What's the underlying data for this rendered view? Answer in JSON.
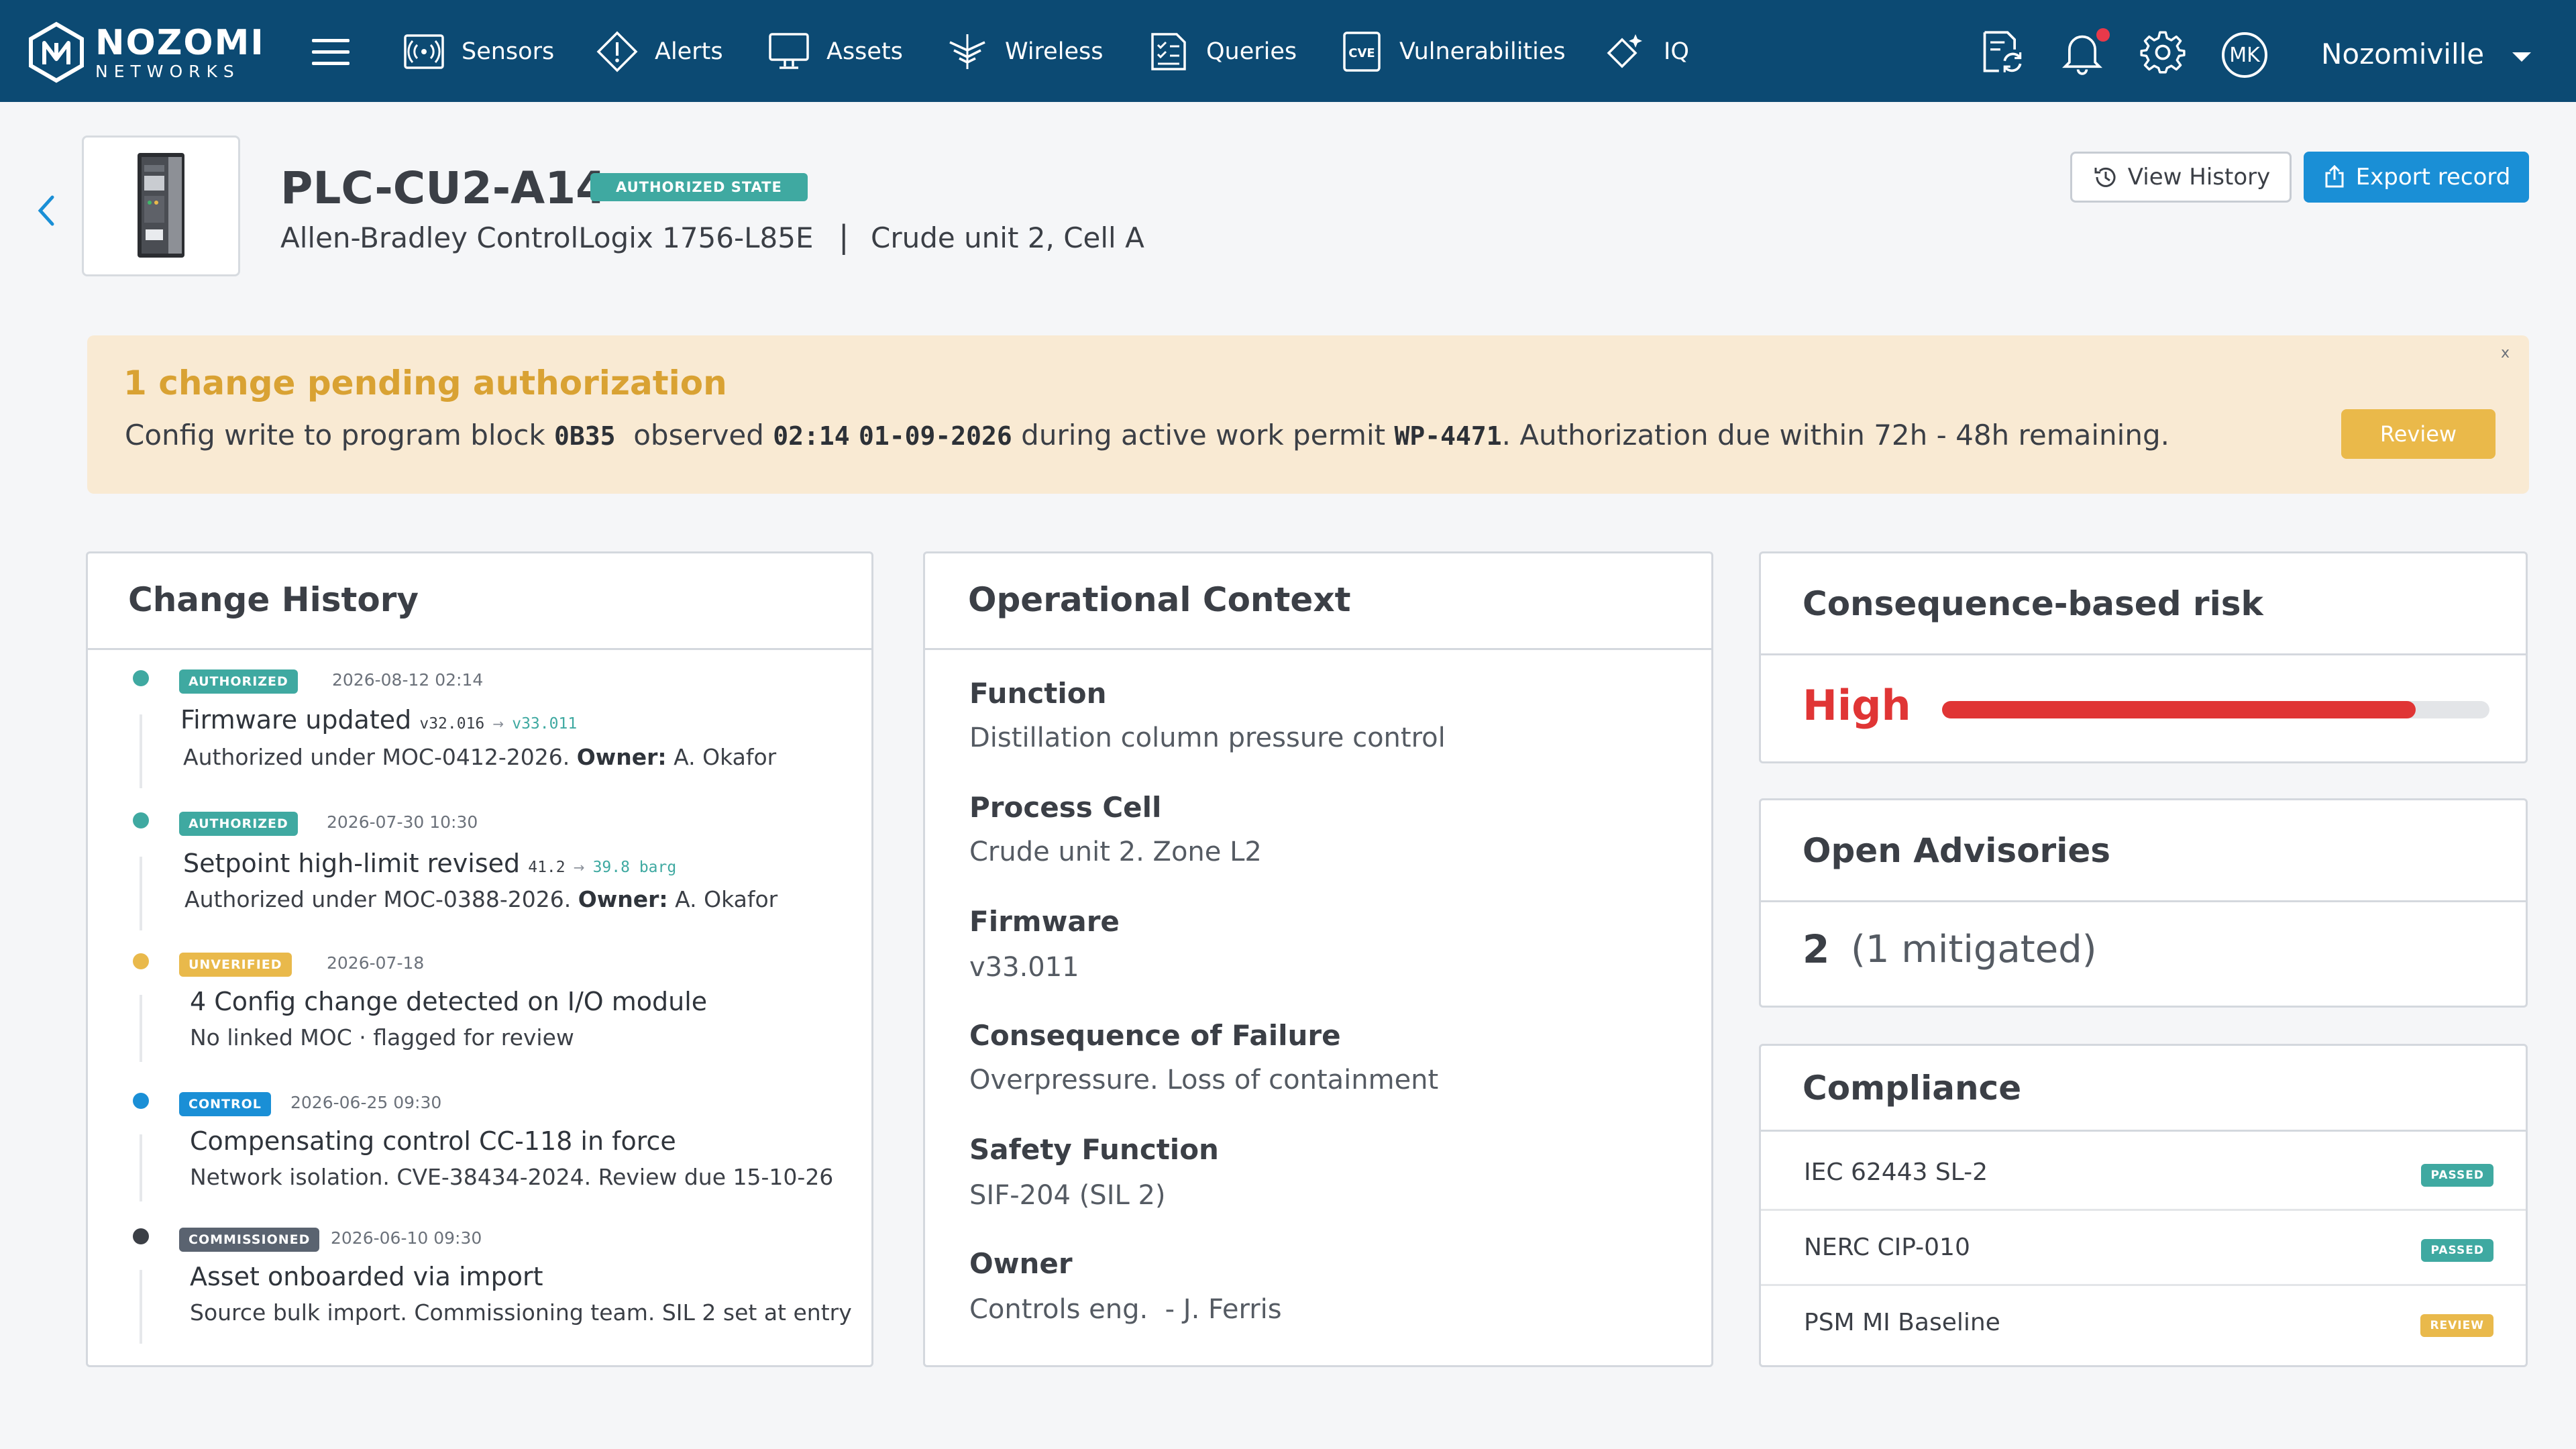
{
  "brand": {
    "line1": "NOZOMI",
    "line2": "NETWORKS"
  },
  "nav": {
    "items": [
      {
        "label": "Sensors",
        "icon": "sensor-icon"
      },
      {
        "label": "Alerts",
        "icon": "alert-icon"
      },
      {
        "label": "Assets",
        "icon": "monitor-icon"
      },
      {
        "label": "Wireless",
        "icon": "wireless-icon"
      },
      {
        "label": "Queries",
        "icon": "queries-icon"
      },
      {
        "label": "Vulnerabilities",
        "icon": "cve-icon"
      },
      {
        "label": "IQ",
        "icon": "iq-icon"
      }
    ],
    "cve_icon_text": "CVE",
    "user_initials": "MK",
    "site": "Nozomiville"
  },
  "asset": {
    "name": "PLC-CU2-A14",
    "state_badge": "AUTHORIZED STATE",
    "model": "Allen-Bradley ControlLogix 1756-L85E",
    "separator": "|",
    "location": "Crude unit 2, Cell A",
    "view_history_label": "View History",
    "export_label": "Export record"
  },
  "banner": {
    "title": "1 change pending authorization",
    "text_1": "Config write to program block",
    "block": "0B35",
    "text_2": "observed",
    "time": "02:14",
    "date": "01-09-2026",
    "text_3": "during active work permit",
    "permit": "WP-4471",
    "text_4": ". Authorization due within 72h - 48h remaining.",
    "close": "x",
    "review_label": "Review"
  },
  "change_history": {
    "title": "Change History",
    "items": [
      {
        "badge": "AUTHORIZED",
        "date": "2026-08-12 02:14",
        "title": "Firmware updated",
        "from": "v32.016",
        "arrow": "→",
        "to": "v33.011",
        "sub": "Authorized under MOC-0412-2026.",
        "owner_label": "Owner:",
        "owner": "A. Okafor",
        "dot_color": "#3fa9a1"
      },
      {
        "badge": "AUTHORIZED",
        "date": "2026-07-30 10:30",
        "title": "Setpoint high-limit revised",
        "from": "41.2",
        "arrow": "→",
        "to": "39.8 barg",
        "sub": "Authorized under MOC-0388-2026.",
        "owner_label": "Owner:",
        "owner": "A. Okafor",
        "dot_color": "#3fa9a1"
      },
      {
        "badge": "UNVERIFIED",
        "date": "2026-07-18",
        "title": "4 Config change detected on I/O module",
        "sub": "No linked MOC · flagged for review",
        "dot_color": "#e9b94b"
      },
      {
        "badge": "CONTROL",
        "date": "2026-06-25 09:30",
        "title": "Compensating control CC-118 in force",
        "sub": "Network isolation. CVE-38434-2024. Review due 15-10-26",
        "dot_color": "#1a8fd6"
      },
      {
        "badge": "COMMISSIONED",
        "date": "2026-06-10 09:30",
        "title": "Asset onboarded via import",
        "sub": "Source bulk import. Commissioning team. SIL 2 set at entry",
        "dot_color": "#3b3f46"
      }
    ]
  },
  "operational_context": {
    "title": "Operational Context",
    "fields": [
      {
        "label": "Function",
        "value": "Distillation column pressure control"
      },
      {
        "label": "Process Cell",
        "value": "Crude unit 2. Zone L2"
      },
      {
        "label": "Firmware",
        "value": "v33.011"
      },
      {
        "label": "Consequence of Failure",
        "value": "Overpressure. Loss of containment"
      },
      {
        "label": "Safety Function",
        "value": "SIF-204 (SIL 2)"
      },
      {
        "label": "Owner",
        "value": "Controls eng.  - J. Ferris"
      }
    ]
  },
  "risk": {
    "title": "Consequence-based risk",
    "level": "High",
    "fraction": 0.865,
    "color": "#e03535"
  },
  "advisories": {
    "title": "Open Advisories",
    "count": "2",
    "mitigated": "(1 mitigated)"
  },
  "compliance": {
    "title": "Compliance",
    "items": [
      {
        "name": "IEC 62443 SL-2",
        "status": "PASSED"
      },
      {
        "name": "NERC CIP-010",
        "status": "PASSED"
      },
      {
        "name": "PSM MI Baseline",
        "status": "REVIEW"
      }
    ]
  }
}
